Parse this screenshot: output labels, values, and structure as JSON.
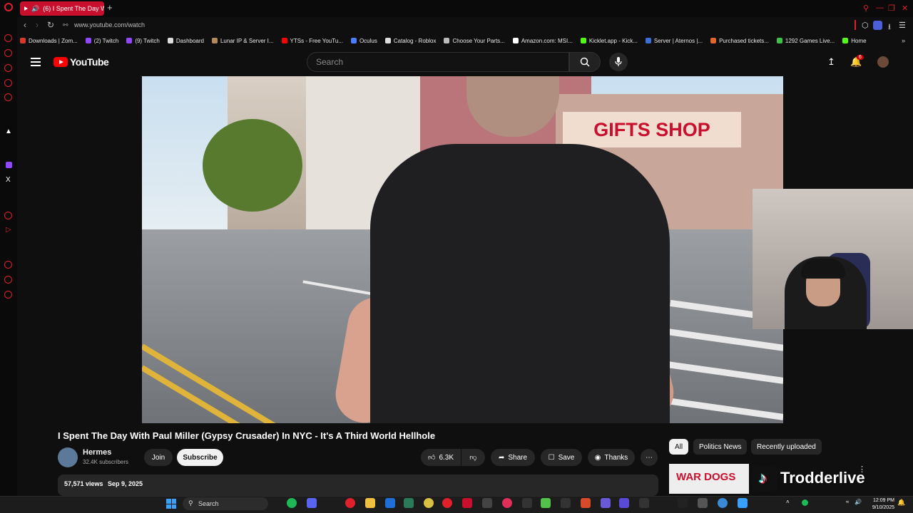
{
  "browser": {
    "tab_title": "(6) I Spent The Day W",
    "url": "www.youtube.com/watch",
    "bookmarks": [
      {
        "label": "Downloads | Zom...",
        "color": "#d83a2a"
      },
      {
        "label": "(2) Twitch",
        "color": "#9146ff"
      },
      {
        "label": "(9) Twitch",
        "color": "#9146ff"
      },
      {
        "label": "Dashboard",
        "color": "#dddddd"
      },
      {
        "label": "Lunar IP & Server I...",
        "color": "#b58a5a"
      },
      {
        "label": "YTSs - Free YouTu...",
        "color": "#ff0000"
      },
      {
        "label": "Oculus",
        "color": "#4a7cff"
      },
      {
        "label": "Catalog - Roblox",
        "color": "#dddddd"
      },
      {
        "label": "Choose Your Parts...",
        "color": "#bbbbbb"
      },
      {
        "label": "Amazon.com: MSI...",
        "color": "#ffffff"
      },
      {
        "label": "Kicklet.app - Kick...",
        "color": "#53fc18"
      },
      {
        "label": "Server | Aternos |...",
        "color": "#3b6fd8"
      },
      {
        "label": "Purchased tickets...",
        "color": "#e0662a"
      },
      {
        "label": "1292 Games Live...",
        "color": "#3ac24a"
      },
      {
        "label": "Home",
        "color": "#53fc18"
      }
    ]
  },
  "youtube": {
    "logo_text": "YouTube",
    "search_placeholder": "Search",
    "notification_count": "6",
    "video_sign": "GIFTS SHOP",
    "video_title": "I Spent The Day With Paul Miller (Gypsy Crusader) In NYC - It's A Third World Hellhole",
    "channel": {
      "name": "Hermes",
      "subscribers": "32.4K subscribers"
    },
    "buttons": {
      "join": "Join",
      "subscribe": "Subscribe",
      "likes": "6.3K",
      "share": "Share",
      "save": "Save",
      "thanks": "Thanks"
    },
    "stats": {
      "views": "57,571 views",
      "date": "Sep 9, 2025"
    },
    "chips": [
      "All",
      "Politics News",
      "Recently uploaded"
    ],
    "recommended_thumb_text": "WAR DOGS"
  },
  "overlay": {
    "tiktok_handle": "Trodderlive"
  },
  "taskbar": {
    "search_label": "Search",
    "time": "12:09 PM",
    "date": "9/10/2025"
  },
  "colors": {
    "accent": "#ff0000",
    "opera": "#e0212b",
    "background": "#0f0f0f"
  }
}
